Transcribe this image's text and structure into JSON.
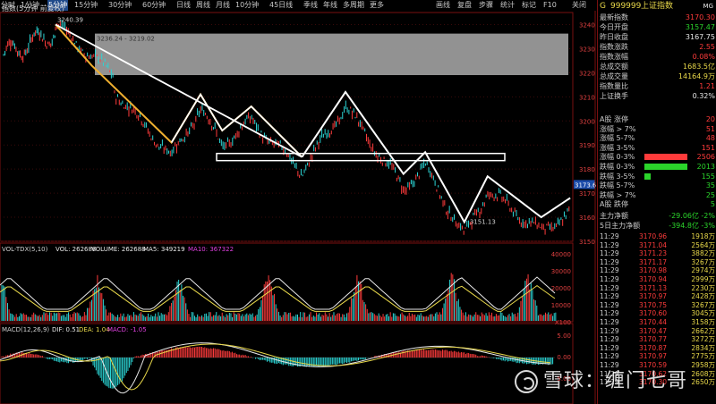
{
  "toolbar": {
    "items": [
      "分时",
      "1分钟",
      "5分钟",
      "15分钟",
      "30分钟",
      "60分钟",
      "日线",
      "周线",
      "月线",
      "10分钟",
      "45日线",
      "季线",
      "年线",
      "多周期",
      "更多"
    ],
    "active_index": 2,
    "right_items": [
      "画线",
      "复盘",
      "步骤",
      "统计",
      "标记",
      "F10",
      "关闭"
    ]
  },
  "chart_header": {
    "main_label": "指数(5分钟 前复权)",
    "high_label": "3240.39",
    "box_label": "3236.24 - 3219.02",
    "low_label": "3151.13",
    "current_price_tag": "3173.6"
  },
  "chart_data": {
    "type": "candlestick",
    "price_axis": {
      "ticks": [
        3240,
        3230,
        3220,
        3210,
        3200,
        3190,
        3180,
        3170,
        3160,
        3150
      ],
      "range": [
        3150,
        3245
      ]
    },
    "volume_axis": {
      "ticks": [
        "40000",
        "30000",
        "20000",
        "10000",
        "X100"
      ]
    },
    "macd_axis": {
      "ticks": [
        "5.00",
        "0.00",
        "-5.00"
      ]
    },
    "volume_header": {
      "label": "VOL-TDX(5,10)",
      "vol": "VOL: 262688",
      "volume": "VOLUME: 262688",
      "ma5": "MA5: 349219",
      "ma10": "MA10: 367322"
    },
    "macd_header": {
      "label": "MACD(12,26,9)",
      "dif": "DIF: 0.51",
      "dea": "DEA: 1.04",
      "macd": "MACD: -1.05"
    },
    "wave_points": [
      [
        3240,
        0
      ],
      [
        3219,
        40
      ],
      [
        3191,
        80
      ],
      [
        3211,
        100
      ],
      [
        3196,
        115
      ],
      [
        3206,
        135
      ],
      [
        3185,
        170
      ],
      [
        3212,
        200
      ],
      [
        3178,
        240
      ],
      [
        3187,
        255
      ],
      [
        3158,
        282
      ],
      [
        3177,
        298
      ],
      [
        3160,
        335
      ],
      [
        3168,
        355
      ]
    ],
    "zone_box": {
      "top": 3236.24,
      "bottom": 3219.02
    },
    "support_line": 3185
  },
  "right_panel": {
    "title_prefix": "G",
    "code": "999999",
    "name": "上证指数",
    "title_suffix": "MG",
    "stats": [
      {
        "label": "最新指数",
        "value": "3170.30",
        "color": "red"
      },
      {
        "label": "今日开盘",
        "value": "3157.47",
        "color": "green"
      },
      {
        "label": "昨日收盘",
        "value": "3167.75",
        "color": "white"
      },
      {
        "label": "指数涨跌",
        "value": "2.55",
        "color": "red"
      },
      {
        "label": "指数涨幅",
        "value": "0.08%",
        "color": "red"
      },
      {
        "label": "总成交额",
        "value": "1683.5亿",
        "color": "yellow"
      },
      {
        "label": "总成交量",
        "value": "14164.9万",
        "color": "yellow"
      },
      {
        "label": "指数量比",
        "value": "1.21",
        "color": "red"
      },
      {
        "label": "上证换手",
        "value": "0.32%",
        "color": "white"
      }
    ],
    "breadth": [
      {
        "label": "A股 涨停",
        "value": "20",
        "color": "red",
        "bar": 0
      },
      {
        "label": "涨幅 > 7%",
        "value": "51",
        "color": "red",
        "bar": 0
      },
      {
        "label": "涨幅 5-7%",
        "value": "48",
        "color": "red",
        "bar": 0
      },
      {
        "label": "涨幅 3-5%",
        "value": "151",
        "color": "red",
        "bar": 0
      },
      {
        "label": "涨幅 0-3%",
        "value": "2506",
        "color": "red",
        "bar": 1
      },
      {
        "label": "跌幅 0-3%",
        "value": "2013",
        "color": "green",
        "bar": 1
      },
      {
        "label": "跌幅 3-5%",
        "value": "155",
        "color": "green",
        "bar": 0.15
      },
      {
        "label": "跌幅 5-7%",
        "value": "35",
        "color": "green",
        "bar": 0
      },
      {
        "label": "跌幅 > 7%",
        "value": "25",
        "color": "green",
        "bar": 0
      },
      {
        "label": "A股 跌停",
        "value": "5",
        "color": "green",
        "bar": 0
      }
    ],
    "capital_flow": [
      {
        "label": "主力净额",
        "value": "-29.06亿",
        "pct": "-2%"
      },
      {
        "label": "5日主力净额",
        "value": "-394.8亿",
        "pct": "-3%"
      }
    ],
    "ticks": [
      {
        "t": "11:29",
        "p": "3170.96",
        "v": "1918万"
      },
      {
        "t": "11:29",
        "p": "3171.04",
        "v": "2564万"
      },
      {
        "t": "11:29",
        "p": "3171.23",
        "v": "3882万"
      },
      {
        "t": "11:29",
        "p": "3171.17",
        "v": "3267万"
      },
      {
        "t": "11:29",
        "p": "3170.98",
        "v": "2974万"
      },
      {
        "t": "11:29",
        "p": "3170.94",
        "v": "2999万"
      },
      {
        "t": "11:29",
        "p": "3171.13",
        "v": "2230万"
      },
      {
        "t": "11:29",
        "p": "3170.97",
        "v": "2428万"
      },
      {
        "t": "11:29",
        "p": "3170.75",
        "v": "3267万"
      },
      {
        "t": "11:29",
        "p": "3170.60",
        "v": "3045万"
      },
      {
        "t": "11:29",
        "p": "3170.44",
        "v": "3158万"
      },
      {
        "t": "11:29",
        "p": "3170.47",
        "v": "2662万"
      },
      {
        "t": "11:29",
        "p": "3170.77",
        "v": "3272万"
      },
      {
        "t": "11:29",
        "p": "3170.87",
        "v": "2834万"
      },
      {
        "t": "11:29",
        "p": "3170.97",
        "v": "2775万"
      },
      {
        "t": "11:29",
        "p": "3170.59",
        "v": "2958万"
      },
      {
        "t": "11:29",
        "p": "3170.62",
        "v": "2608万"
      },
      {
        "t": "11:29",
        "p": "3170.30",
        "v": "2650万"
      }
    ]
  },
  "watermark": {
    "text": "雪球：缠门七哥"
  },
  "colors": {
    "up": "#ff3b3b",
    "down": "#2bd5d5",
    "grid": "#7a1010",
    "wave_yellow": "#f0b030",
    "wave_white": "#ffffff"
  }
}
